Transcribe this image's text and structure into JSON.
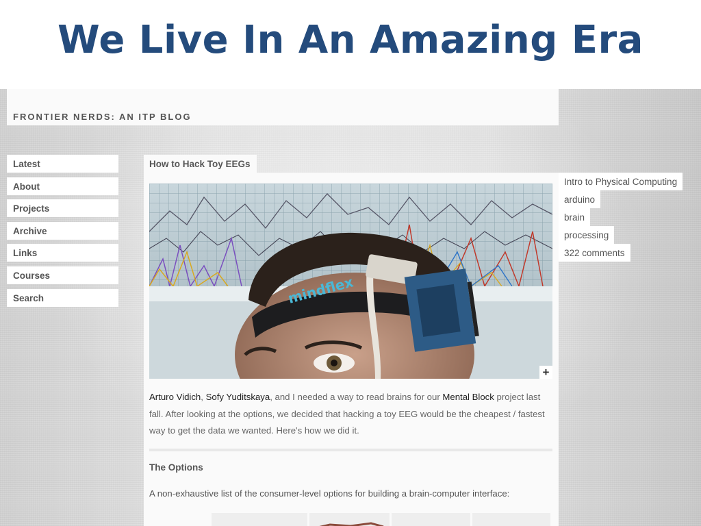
{
  "slide": {
    "title": "We Live In An Amazing Era"
  },
  "blog": {
    "title": "FRONTIER NERDS: AN ITP BLOG"
  },
  "nav": {
    "items": [
      {
        "label": "Latest"
      },
      {
        "label": "About"
      },
      {
        "label": "Projects"
      },
      {
        "label": "Archive"
      },
      {
        "label": "Links"
      },
      {
        "label": "Courses"
      },
      {
        "label": "Search"
      }
    ]
  },
  "post": {
    "title": "How to Hack Toy EEGs",
    "image_expand": "+",
    "image_headband_text": "mindflex",
    "intro": {
      "author1": "Arturo Vidich",
      "sep1": ", ",
      "author2": "Sofy Yuditskaya",
      "mid": ", and I needed a way to read brains for our ",
      "project": "Mental Block",
      "rest": " project last fall. After looking at the options, we decided that hacking a toy EEG would be the cheapest / fastest way to get the data we wanted. Here's how we did it."
    },
    "section_title": "The Options",
    "section_text": "A non-exhaustive list of the consumer-level options for building a brain-computer interface:"
  },
  "meta": {
    "tags": [
      {
        "label": "Intro to Physical Computing"
      },
      {
        "label": "arduino"
      },
      {
        "label": "brain"
      },
      {
        "label": "processing"
      }
    ],
    "comments": "322 comments"
  }
}
